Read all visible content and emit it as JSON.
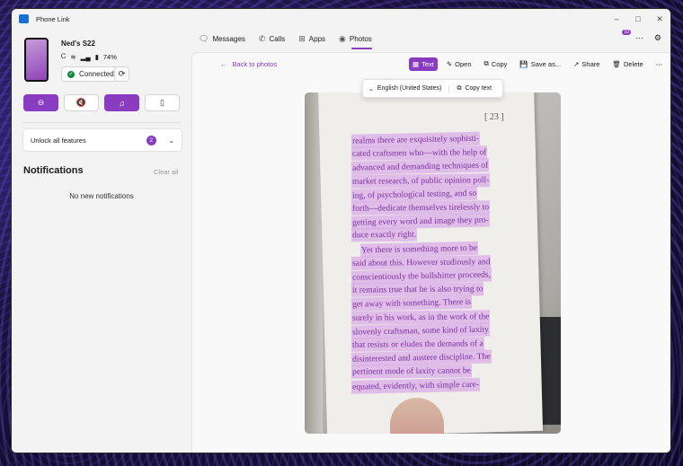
{
  "window": {
    "title": "Phone Link"
  },
  "device": {
    "name": "Ned's S22",
    "battery": "74%",
    "status": "Connected"
  },
  "unlock": {
    "label": "Unlock all features",
    "badge": "2"
  },
  "notifications": {
    "title": "Notifications",
    "clear_all": "Clear all",
    "empty": "No new notifications"
  },
  "nav": {
    "tabs": [
      "Messages",
      "Calls",
      "Apps",
      "Photos"
    ],
    "active": "Photos",
    "notif_count": "10"
  },
  "photo_view": {
    "back": "Back to photos",
    "toolbar": [
      "Text",
      "Open",
      "Copy",
      "Save as...",
      "Share",
      "Delete"
    ],
    "language": "English (United States)",
    "copy_text": "Copy text",
    "page_number": "[ 23 ]",
    "lines": [
      "realms there are exquisitely sophisti-",
      "cated craftsmen who—with the help of",
      "advanced and demanding techniques of",
      "market research, of public opinion poll-",
      "ing, of psychological testing, and so",
      "forth—dedicate themselves tirelessly to",
      "getting every word and image they pro-",
      "duce exactly right.",
      "Yet there is something more to be",
      "said about this. However studiously and",
      "conscientiously the bullshitter proceeds,",
      "it remains true that he is also trying to",
      "get away with something. There is",
      "surely in his work, as in the work of the",
      "slovenly craftsman, some kind of laxity",
      "that resists or eludes the demands of a",
      "disinterested and austere discipline. The",
      "pertinent mode of laxity cannot be",
      "equated, evidently, with simple care-"
    ]
  },
  "colors": {
    "accent": "#8a3cc0",
    "connected": "#10893e"
  }
}
